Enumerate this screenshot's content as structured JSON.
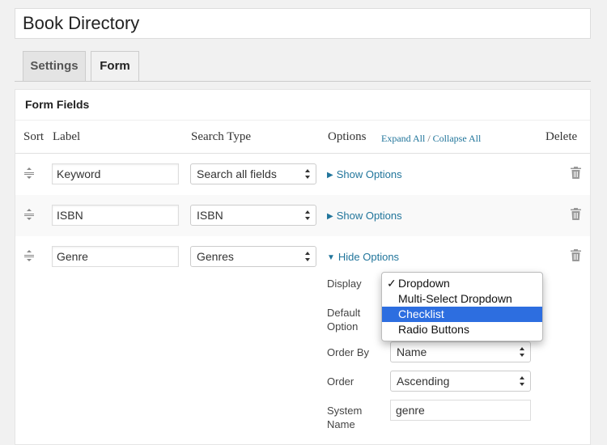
{
  "page_title": "Book Directory",
  "tabs": [
    {
      "label": "Settings",
      "active": false
    },
    {
      "label": "Form",
      "active": true
    }
  ],
  "panel": {
    "title": "Form Fields",
    "columns": {
      "sort": "Sort",
      "label": "Label",
      "search_type": "Search Type",
      "options": "Options",
      "delete": "Delete"
    },
    "expand_all": "Expand All",
    "separator": " / ",
    "collapse_all": "Collapse All"
  },
  "rows": [
    {
      "label": "Keyword",
      "search_type": "Search all fields",
      "toggle": "Show Options",
      "expanded": false
    },
    {
      "label": "ISBN",
      "search_type": "ISBN",
      "toggle": "Show Options",
      "expanded": false
    },
    {
      "label": "Genre",
      "search_type": "Genres",
      "toggle": "Hide Options",
      "expanded": true
    }
  ],
  "genre_options": {
    "display_label": "Display",
    "default_option_label_1": "Default",
    "default_option_label_2": "Option",
    "order_by_label": "Order By",
    "order_by_value": "Name",
    "order_label": "Order",
    "order_value": "Ascending",
    "system_name_label_1": "System",
    "system_name_label_2": "Name",
    "system_name_value": "genre"
  },
  "display_dropdown": {
    "check_glyph": "✓",
    "options": [
      "Dropdown",
      "Multi-Select Dropdown",
      "Checklist",
      "Radio Buttons"
    ],
    "selected_index": 0,
    "highlighted_index": 2
  },
  "colors": {
    "link": "#21759b",
    "highlight": "#2d6ee0"
  },
  "icons": {
    "sort": "drag-handle-icon",
    "delete": "trash-icon",
    "select": "select-arrows-icon"
  }
}
